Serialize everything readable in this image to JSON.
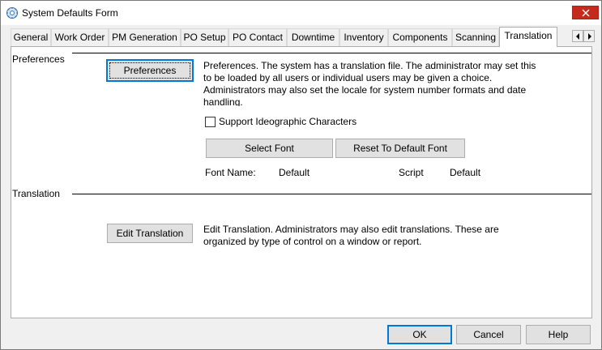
{
  "window": {
    "title": "System Defaults Form"
  },
  "tabs": [
    {
      "label": "General"
    },
    {
      "label": "Work Order"
    },
    {
      "label": "PM Generation"
    },
    {
      "label": "PO Setup"
    },
    {
      "label": "PO Contact"
    },
    {
      "label": "Downtime"
    },
    {
      "label": "Inventory"
    },
    {
      "label": "Components"
    },
    {
      "label": "Scanning"
    },
    {
      "label": "Translation",
      "active": true
    }
  ],
  "preferences": {
    "section_label": "Preferences",
    "button_label": "Preferences",
    "description": "Preferences.  The system has a translation file.  The administrator may set this to be loaded by all users or individual users may be given a choice. Administrators may also set the locale for system number formats and date handling.",
    "checkbox_label": "Support Ideographic Characters",
    "checkbox_checked": false,
    "select_font_label": "Select Font",
    "reset_font_label": "Reset To Default Font",
    "font_name_label": "Font Name:",
    "font_name_value": "Default",
    "script_label": "Script",
    "script_value": "Default"
  },
  "translation": {
    "section_label": "Translation",
    "button_label": "Edit Translation",
    "description": "Edit Translation.  Administrators may also edit translations.  These are organized by type of control on a window or report."
  },
  "footer": {
    "ok_label": "OK",
    "cancel_label": "Cancel",
    "help_label": "Help"
  },
  "colors": {
    "accent": "#0078d7",
    "close_button": "#c42b1c"
  }
}
